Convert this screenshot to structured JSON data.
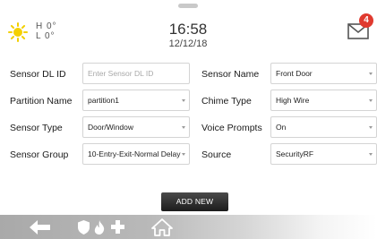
{
  "header": {
    "weather": {
      "icon": "sun-icon",
      "high": "H 0°",
      "low": "L 0°"
    },
    "time": "16:58",
    "date": "12/12/18",
    "messages": {
      "icon": "envelope-icon",
      "count": "4"
    }
  },
  "form": {
    "left": [
      {
        "label": "Sensor DL ID",
        "value": "",
        "placeholder": "Enter Sensor DL ID",
        "kind": "input"
      },
      {
        "label": "Partition Name",
        "value": "partition1",
        "kind": "select"
      },
      {
        "label": "Sensor Type",
        "value": "Door/Window",
        "kind": "select"
      },
      {
        "label": "Sensor Group",
        "value": "10-Entry-Exit-Normal Delay",
        "kind": "select"
      }
    ],
    "right": [
      {
        "label": "Sensor Name",
        "value": "Front Door",
        "kind": "select"
      },
      {
        "label": "Chime Type",
        "value": "High Wire",
        "kind": "select"
      },
      {
        "label": "Voice Prompts",
        "value": "On",
        "kind": "select"
      },
      {
        "label": "Source",
        "value": "SecurityRF",
        "kind": "select"
      }
    ]
  },
  "actions": {
    "add_new": "ADD NEW"
  },
  "navbar": {
    "icons": [
      "back-arrow-icon",
      "shield-icon",
      "fire-icon",
      "medical-cross-icon",
      "home-icon"
    ]
  },
  "colors": {
    "badge": "#e03a2f",
    "sun": "#f5d000",
    "button": "#2b2b2b"
  }
}
